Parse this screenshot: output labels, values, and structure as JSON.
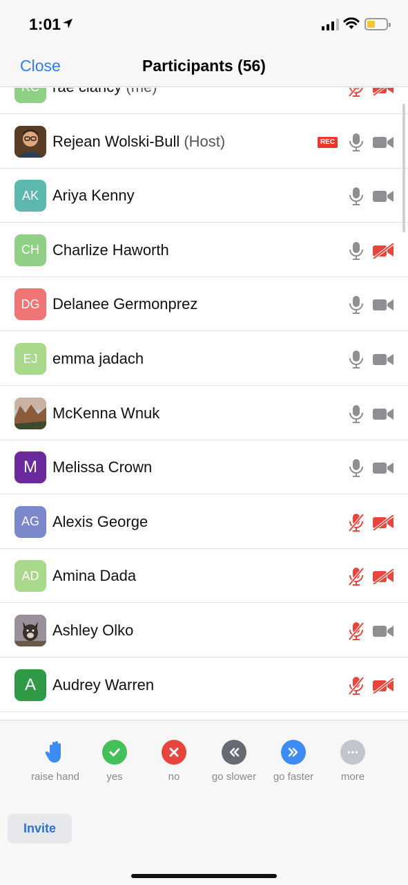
{
  "status_bar": {
    "time": "1:01",
    "battery_color": "#f4c531"
  },
  "nav": {
    "close_label": "Close",
    "title": "Participants (56)"
  },
  "colors": {
    "accent": "#2d7cf6",
    "muted_red": "#e8372d",
    "unmuted_gray": "#8e8e93"
  },
  "participants": [
    {
      "initials": "RC",
      "name": "rae clancy",
      "tag": "(me)",
      "avatar_color": "#8fcf86",
      "avatar_type": "initials",
      "rec": false,
      "mic": "muted",
      "video": "off"
    },
    {
      "initials": "",
      "name": "Rejean Wolski-Bull",
      "tag": "(Host)",
      "avatar_color": "#6b4a2e",
      "avatar_type": "photo-portrait",
      "rec": true,
      "rec_label": "REC",
      "mic": "on",
      "video": "on"
    },
    {
      "initials": "AK",
      "name": "Ariya Kenny",
      "tag": "",
      "avatar_color": "#5cb8ad",
      "avatar_type": "initials",
      "rec": false,
      "mic": "on",
      "video": "on"
    },
    {
      "initials": "CH",
      "name": "Charlize Haworth",
      "tag": "",
      "avatar_color": "#8fcf86",
      "avatar_type": "initials",
      "rec": false,
      "mic": "on",
      "video": "off"
    },
    {
      "initials": "DG",
      "name": "Delanee Germonprez",
      "tag": "",
      "avatar_color": "#f07676",
      "avatar_type": "initials",
      "rec": false,
      "mic": "on",
      "video": "on"
    },
    {
      "initials": "EJ",
      "name": "emma jadach",
      "tag": "",
      "avatar_color": "#a8d889",
      "avatar_type": "initials",
      "rec": false,
      "mic": "on",
      "video": "on"
    },
    {
      "initials": "",
      "name": "McKenna Wnuk",
      "tag": "",
      "avatar_color": "#a7704a",
      "avatar_type": "photo-landscape",
      "rec": false,
      "mic": "on",
      "video": "on"
    },
    {
      "initials": "M",
      "name": "Melissa Crown",
      "tag": "",
      "avatar_color": "#6a2a9e",
      "avatar_type": "initials",
      "rec": false,
      "mic": "on",
      "video": "on"
    },
    {
      "initials": "AG",
      "name": "Alexis George",
      "tag": "",
      "avatar_color": "#7b88cc",
      "avatar_type": "initials",
      "rec": false,
      "mic": "muted",
      "video": "off"
    },
    {
      "initials": "AD",
      "name": "Amina Dada",
      "tag": "",
      "avatar_color": "#a8d889",
      "avatar_type": "initials",
      "rec": false,
      "mic": "muted",
      "video": "off"
    },
    {
      "initials": "",
      "name": "Ashley Olko",
      "tag": "",
      "avatar_color": "#7a6a78",
      "avatar_type": "photo-dog",
      "rec": false,
      "mic": "muted",
      "video": "on"
    },
    {
      "initials": "A",
      "name": "Audrey Warren",
      "tag": "",
      "avatar_color": "#2f9a45",
      "avatar_type": "initials",
      "rec": false,
      "mic": "muted",
      "video": "off"
    }
  ],
  "reactions": [
    {
      "label": "raise hand",
      "icon": "raise-hand-icon",
      "color": "#3d8cf4"
    },
    {
      "label": "yes",
      "icon": "check-icon",
      "color": "#44c05b"
    },
    {
      "label": "no",
      "icon": "x-icon",
      "color": "#e8453c"
    },
    {
      "label": "go slower",
      "icon": "rewind-icon",
      "color": "#676a73"
    },
    {
      "label": "go faster",
      "icon": "fast-forward-icon",
      "color": "#3d8cf4"
    },
    {
      "label": "more",
      "icon": "ellipsis-icon",
      "color": "#c2c5cf"
    }
  ],
  "invite_label": "Invite"
}
